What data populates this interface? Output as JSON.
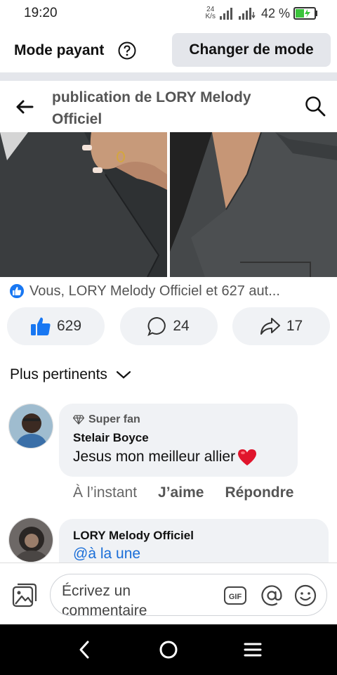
{
  "status_bar": {
    "time": "19:20",
    "speed_value": "24",
    "speed_unit": "K/s",
    "battery_percent": "42 %"
  },
  "mode_bar": {
    "title": "Mode payant",
    "change_button_label": "Changer de mode"
  },
  "post_header": {
    "title": "publication de LORY Melody Officiel"
  },
  "reactions": {
    "summary": "Vous, LORY Melody Officiel et 627 aut...",
    "like_count": "629",
    "comment_count": "24",
    "share_count": "17"
  },
  "sort": {
    "label": "Plus pertinents"
  },
  "comments": [
    {
      "badge": "Super fan",
      "author": "Stelair Boyce",
      "text": "Jesus mon meilleur allier",
      "time": "À l’instant",
      "like_label": "J’aime",
      "reply_label": "Répondre"
    },
    {
      "author": "LORY Melody Officiel",
      "text": "@à la une"
    }
  ],
  "composer": {
    "placeholder": "Écrivez un commentaire",
    "gif_label": "GIF"
  },
  "colors": {
    "accent": "#1877f2",
    "pill_bg": "#f0f2f5",
    "mention": "#1a6ed8",
    "battery": "#3bc43b"
  }
}
